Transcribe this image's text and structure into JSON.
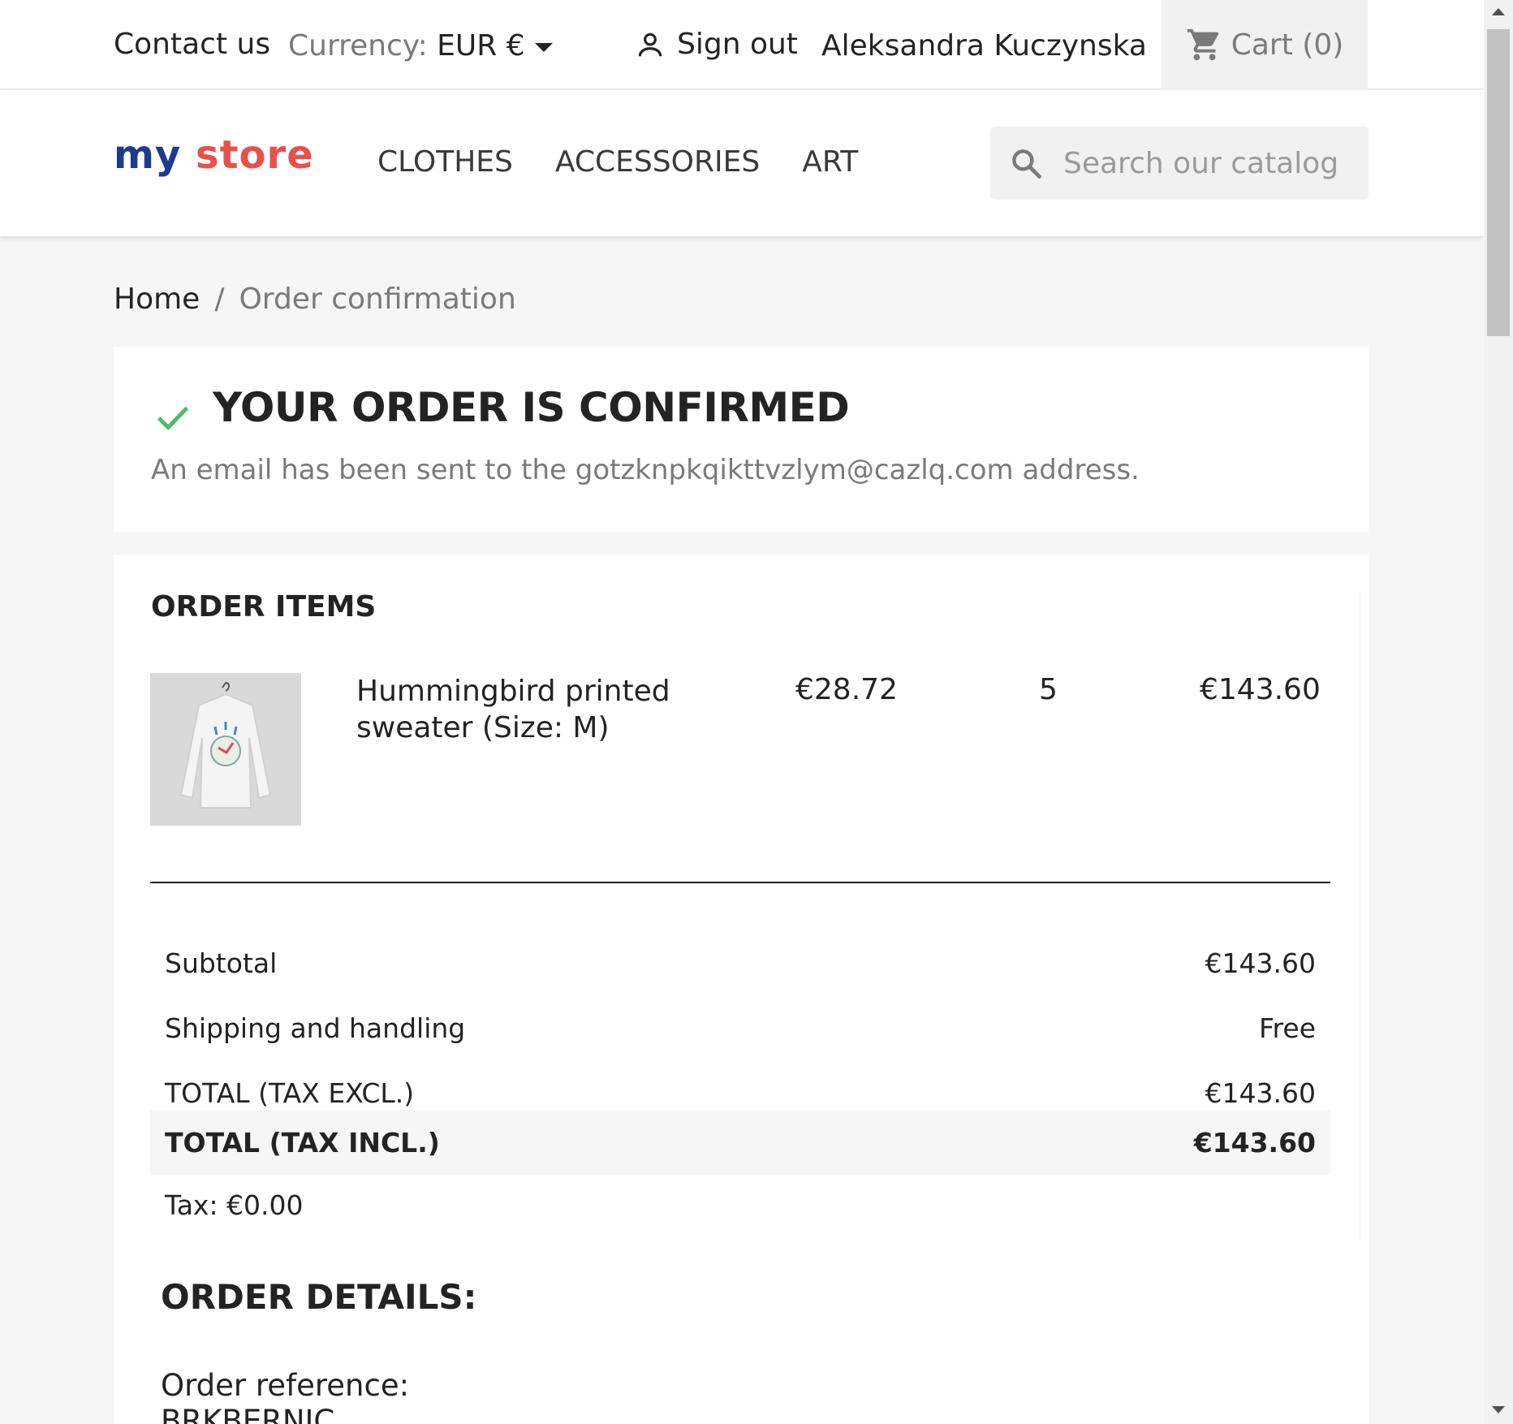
{
  "topbar": {
    "contact_label": "Contact us",
    "currency_label": "Currency:",
    "currency_value": "EUR €",
    "signout_label": "Sign out",
    "user_name": "Aleksandra Kuczynska",
    "cart_label": "Cart",
    "cart_count": "(0)"
  },
  "header": {
    "logo_part1": "my",
    "logo_part2": "store",
    "nav": [
      "CLOTHES",
      "ACCESSORIES",
      "ART"
    ],
    "search_placeholder": "Search our catalog"
  },
  "breadcrumb": {
    "home": "Home",
    "separator": "/",
    "current": "Order confirmation"
  },
  "confirmation": {
    "title": "YOUR ORDER IS CONFIRMED",
    "message": "An email has been sent to the gotzknpkqikttvzlym@cazlq.com address."
  },
  "order_items": {
    "heading": "ORDER ITEMS",
    "items": [
      {
        "name": "Hummingbird printed sweater (Size: M)",
        "unit_price": "€28.72",
        "quantity": "5",
        "total": "€143.60"
      }
    ],
    "totals": [
      {
        "label": "Subtotal",
        "value": "€143.60"
      },
      {
        "label": "Shipping and handling",
        "value": "Free"
      },
      {
        "label": "TOTAL (TAX EXCL.)",
        "value": "€143.60"
      },
      {
        "label": "TOTAL (TAX INCL.)",
        "value": "€143.60"
      }
    ],
    "tax_line": "Tax: €0.00"
  },
  "order_details": {
    "heading": "ORDER DETAILS:",
    "reference_label": "Order reference:",
    "reference_value": "BRKBERNIC"
  },
  "colors": {
    "accent_check": "#4cbb6c",
    "logo_blue": "#1d3a8f",
    "logo_red": "#e8514b"
  }
}
